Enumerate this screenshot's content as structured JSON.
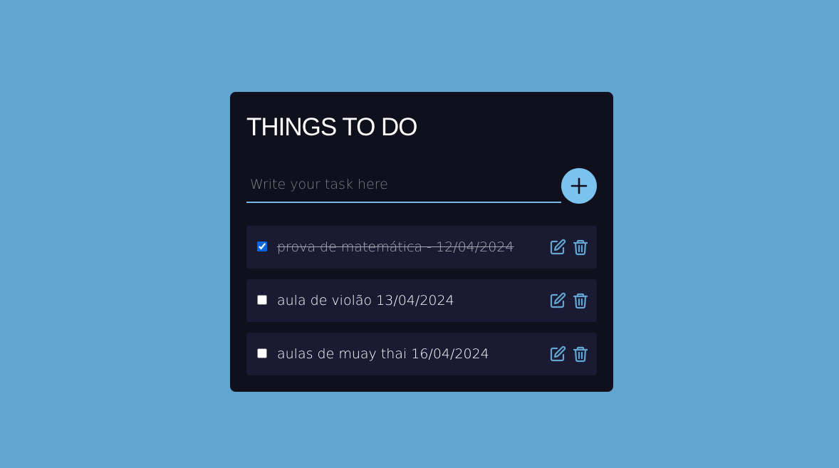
{
  "app": {
    "title": "THINGS TO DO"
  },
  "input": {
    "placeholder": "Write your task here",
    "value": ""
  },
  "add_button": {
    "icon": "plus-icon"
  },
  "tasks": [
    {
      "text": "prova de matemática - 12/04/2024",
      "checked": true
    },
    {
      "text": "aula de violão 13/04/2024",
      "checked": false
    },
    {
      "text": "aulas de muay thai 16/04/2024",
      "checked": false
    }
  ],
  "icons": {
    "edit": "edit-icon",
    "delete": "trash-icon"
  },
  "colors": {
    "background": "#62a5d0",
    "card": "#10101c",
    "task_item": "#1b1a33",
    "accent": "#7cc2ef",
    "icon": "#62a5d0",
    "checkbox": "#0a66e0"
  }
}
